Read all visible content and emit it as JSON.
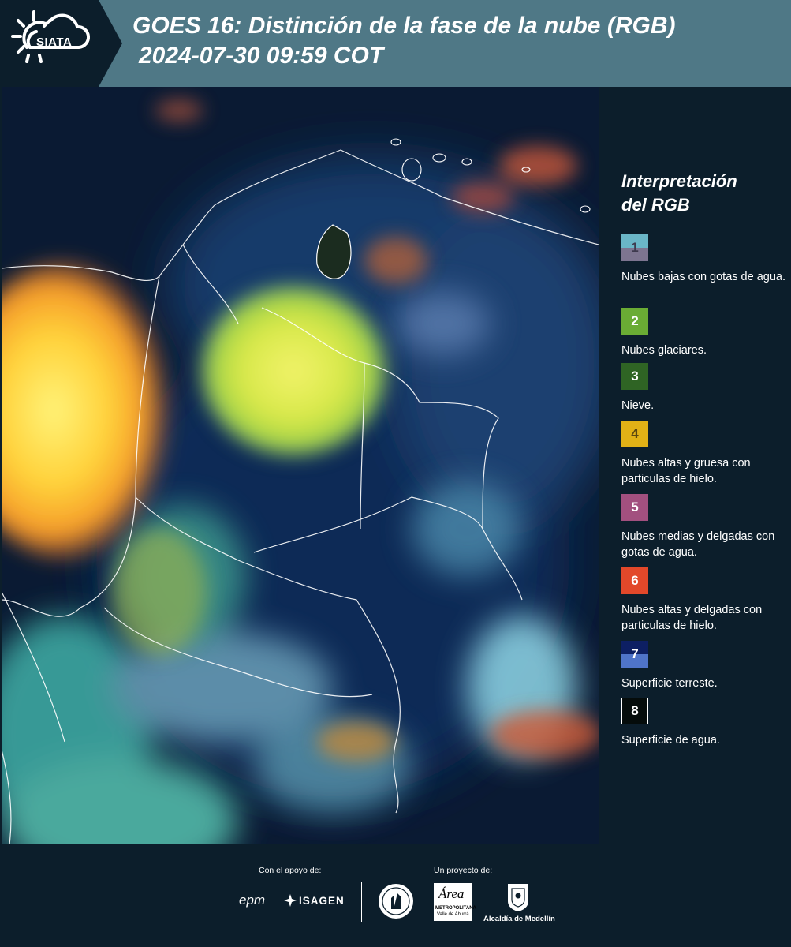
{
  "header": {
    "logo_text": "SIATA",
    "title_line1": "GOES 16: Distinción de la fase de la nube (RGB)",
    "title_line2": "2024-07-30 09:59 COT"
  },
  "legend": {
    "title_line1": "Interpretación",
    "title_line2": "del RGB",
    "items": [
      {
        "number": "1",
        "label": "Nubes bajas con gotas de agua.",
        "color_top": "#6ab6c7",
        "color_bottom": "#7d7590"
      },
      {
        "number": "2",
        "label": "Nubes glaciares.",
        "color": "#6aac34"
      },
      {
        "number": "3",
        "label": "Nieve.",
        "color": "#2f6424"
      },
      {
        "number": "4",
        "label": "Nubes altas y gruesa con particulas de hielo.",
        "color": "#e1b116"
      },
      {
        "number": "5",
        "label": "Nubes medias y delgadas con gotas de agua.",
        "color": "#a2507f"
      },
      {
        "number": "6",
        "label": "Nubes altas y delgadas con particulas de hielo.",
        "color": "#e2482a"
      },
      {
        "number": "7",
        "label": "Superficie terreste.",
        "color_top": "#0d1f63",
        "color_bottom": "#4f74c9"
      },
      {
        "number": "8",
        "label": "Superficie de agua.",
        "color": "#050c0b"
      }
    ]
  },
  "footer": {
    "support_label": "Con el apoyo de:",
    "project_label": "Un proyecto de:",
    "sponsor_epm": "epm",
    "sponsor_isagen": "ISAGEN",
    "amva_name": "Área",
    "amva_sub1": "METROPOLITANA",
    "amva_sub2": "Valle de Aburrá",
    "medellin_name": "Alcaldía de Medellín"
  }
}
